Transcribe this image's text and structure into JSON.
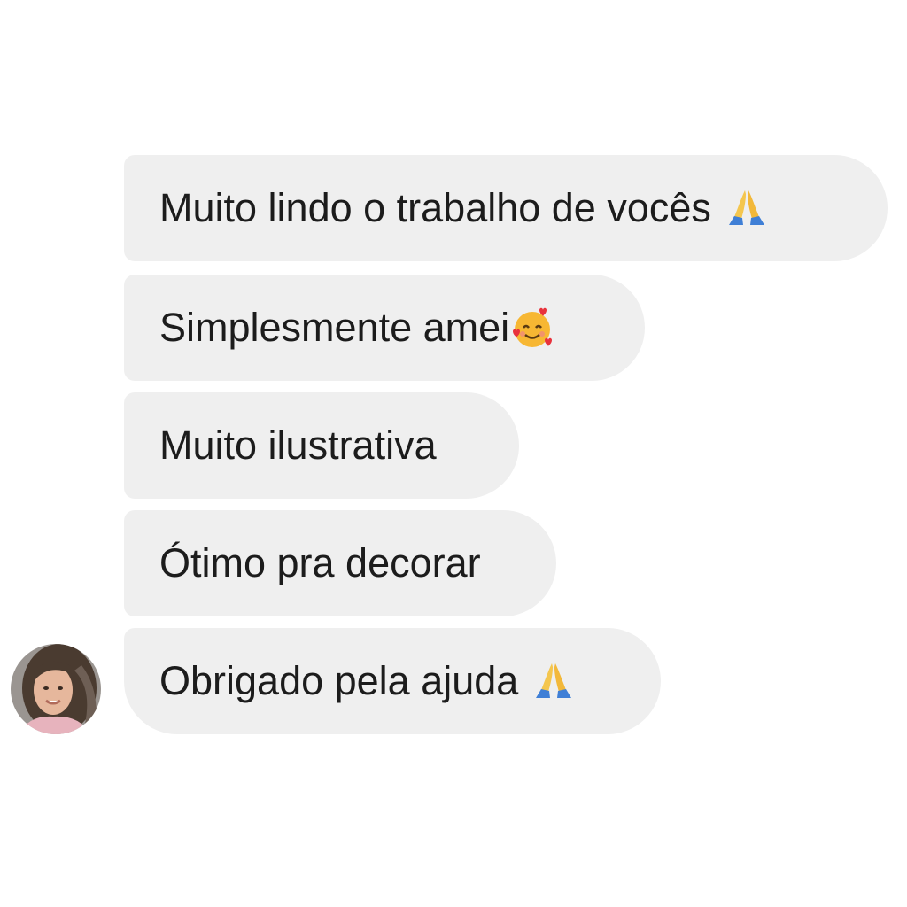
{
  "messages": [
    {
      "text": "Muito lindo o trabalho de vocês",
      "emoji": "folded-hands"
    },
    {
      "text": "Simplesmente amei",
      "emoji": "smiling-face-with-hearts"
    },
    {
      "text": "Muito ilustrativa",
      "emoji": ""
    },
    {
      "text": "Ótimo pra decorar",
      "emoji": ""
    },
    {
      "text": "Obrigado pela ajuda",
      "emoji": "folded-hands"
    }
  ],
  "avatar": {
    "icon": "user-avatar-photo"
  },
  "colors": {
    "bubble": "#efefef",
    "text": "#1c1c1c",
    "background": "#ffffff"
  }
}
